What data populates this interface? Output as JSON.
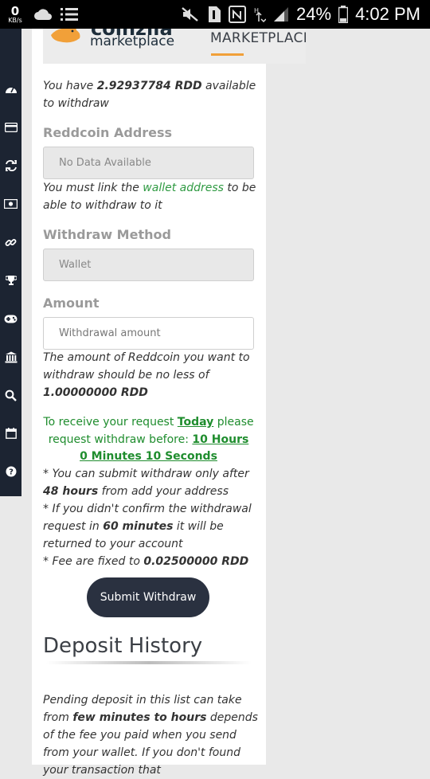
{
  "status_bar": {
    "net_speed": "0",
    "net_unit": "KB/s",
    "battery": "24%",
    "time": "4:02 PM"
  },
  "header": {
    "logo_top": "coinzila",
    "logo_sub": "marketplace",
    "nav_item": "MARKETPLACE"
  },
  "balance": {
    "prefix": "You have ",
    "amount": "2.92937784 RDD",
    "suffix": " available to withdraw"
  },
  "address": {
    "label": "Reddcoin Address",
    "value": "No Data Available",
    "help_prefix": "You must link the ",
    "help_link": "wallet address",
    "help_suffix": " to be able to withdraw to it"
  },
  "method": {
    "label": "Withdraw Method",
    "value": "Wallet"
  },
  "amount": {
    "label": "Amount",
    "placeholder": "Withdrawal amount",
    "help_prefix": "The amount of Reddcoin you want to withdraw should be no less of ",
    "help_min": "1.00000000 RDD"
  },
  "notice": {
    "text1": "To receive your request ",
    "today": "Today",
    "text2": " please request withdraw before: ",
    "countdown": "10 Hours 0 Minutes 10 Seconds"
  },
  "rules": {
    "r1_a": "* You can submit withdraw only after ",
    "r1_b": "48 hours",
    "r1_c": " from add your address",
    "r2_a": "* If you didn't confirm the withdrawal request in ",
    "r2_b": "60 minutes",
    "r2_c": " it will be returned to your account",
    "r3_a": "* Fee are fixed to ",
    "r3_b": "0.02500000 RDD"
  },
  "submit_label": "Submit Withdraw",
  "deposit": {
    "title": "Deposit History",
    "text_a": "Pending deposit in this list can take from ",
    "text_b": "few minutes to hours",
    "text_c": " depends of the fee you paid when you send from your wallet. If you don't found your transaction that"
  },
  "colors": {
    "sidebar": "#1c2432",
    "accent_green": "#2f9a42",
    "button": "#2a3140",
    "nav_underline": "#f1a039"
  }
}
